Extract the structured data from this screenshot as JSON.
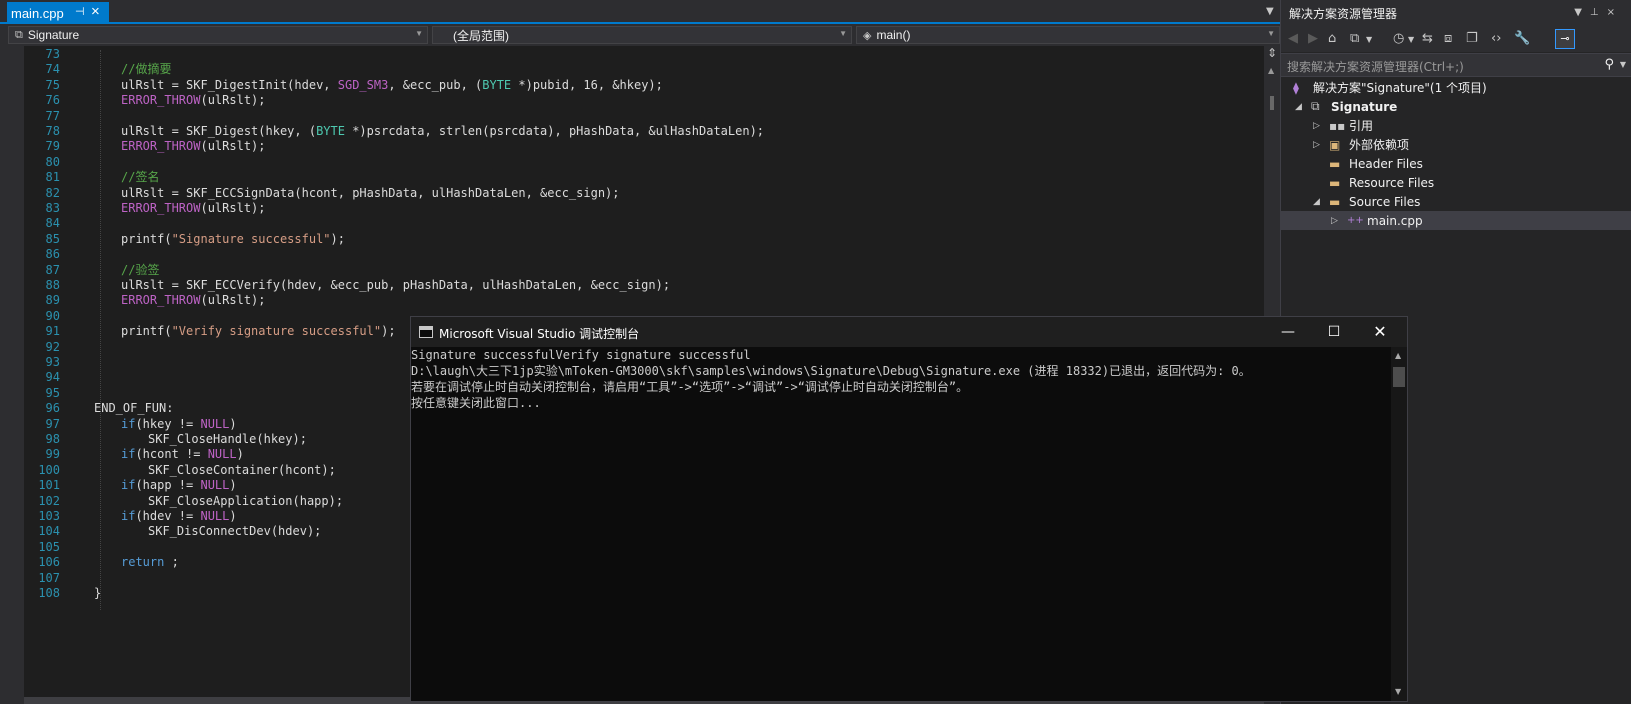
{
  "editor": {
    "tab": {
      "title": "main.cpp",
      "pin_icon": "pin-icon",
      "close_icon": "close-icon"
    },
    "nav": {
      "project": "Signature",
      "scope": "(全局范围)",
      "member": "main()"
    },
    "lines": [
      {
        "n": "73",
        "parts": []
      },
      {
        "n": "74",
        "parts": [
          {
            "t": "//做摘要",
            "c": "cmt"
          }
        ]
      },
      {
        "n": "75",
        "parts": [
          {
            "t": "ulRslt = SKF_DigestInit(hdev, ",
            "c": ""
          },
          {
            "t": "SGD_SM3",
            "c": "mac"
          },
          {
            "t": ", &ecc_pub, (",
            "c": ""
          },
          {
            "t": "BYTE",
            "c": "typ"
          },
          {
            "t": " *)pubid, 16, &hkey);",
            "c": ""
          }
        ]
      },
      {
        "n": "76",
        "parts": [
          {
            "t": "ERROR_THROW",
            "c": "mac"
          },
          {
            "t": "(ulRslt);",
            "c": ""
          }
        ]
      },
      {
        "n": "77",
        "parts": []
      },
      {
        "n": "78",
        "parts": [
          {
            "t": "ulRslt = SKF_Digest(hkey, (",
            "c": ""
          },
          {
            "t": "BYTE",
            "c": "typ"
          },
          {
            "t": " *)psrcdata, strlen(psrcdata), pHashData, &ulHashDataLen);",
            "c": ""
          }
        ]
      },
      {
        "n": "79",
        "parts": [
          {
            "t": "ERROR_THROW",
            "c": "mac"
          },
          {
            "t": "(ulRslt);",
            "c": ""
          }
        ]
      },
      {
        "n": "80",
        "parts": []
      },
      {
        "n": "81",
        "parts": [
          {
            "t": "//签名",
            "c": "cmt"
          }
        ]
      },
      {
        "n": "82",
        "parts": [
          {
            "t": "ulRslt = SKF_ECCSignData(hcont, pHashData, ulHashDataLen, &ecc_sign);",
            "c": ""
          }
        ]
      },
      {
        "n": "83",
        "parts": [
          {
            "t": "ERROR_THROW",
            "c": "mac"
          },
          {
            "t": "(ulRslt);",
            "c": ""
          }
        ]
      },
      {
        "n": "84",
        "parts": []
      },
      {
        "n": "85",
        "parts": [
          {
            "t": "printf(",
            "c": ""
          },
          {
            "t": "\"Signature successful\"",
            "c": "str"
          },
          {
            "t": ");",
            "c": ""
          }
        ]
      },
      {
        "n": "86",
        "parts": []
      },
      {
        "n": "87",
        "parts": [
          {
            "t": "//验签",
            "c": "cmt"
          }
        ]
      },
      {
        "n": "88",
        "parts": [
          {
            "t": "ulRslt = SKF_ECCVerify(hdev, &ecc_pub, pHashData, ulHashDataLen, &ecc_sign);",
            "c": ""
          }
        ]
      },
      {
        "n": "89",
        "parts": [
          {
            "t": "ERROR_THROW",
            "c": "mac"
          },
          {
            "t": "(ulRslt);",
            "c": ""
          }
        ]
      },
      {
        "n": "90",
        "parts": []
      },
      {
        "n": "91",
        "parts": [
          {
            "t": "printf(",
            "c": ""
          },
          {
            "t": "\"Verify signature successful\"",
            "c": "str"
          },
          {
            "t": ");",
            "c": ""
          }
        ]
      },
      {
        "n": "92",
        "parts": []
      },
      {
        "n": "93",
        "parts": []
      },
      {
        "n": "94",
        "parts": []
      },
      {
        "n": "95",
        "parts": []
      },
      {
        "n": "96",
        "parts": [
          {
            "t": "END_OF_FUN:",
            "c": ""
          }
        ]
      },
      {
        "n": "97",
        "parts": [
          {
            "t": "if",
            "c": "kw"
          },
          {
            "t": "(hkey != ",
            "c": ""
          },
          {
            "t": "NULL",
            "c": "mac"
          },
          {
            "t": ")",
            "c": ""
          }
        ]
      },
      {
        "n": "98",
        "parts": [
          {
            "t": "SKF_CloseHandle(hkey);",
            "c": ""
          }
        ]
      },
      {
        "n": "99",
        "parts": [
          {
            "t": "if",
            "c": "kw"
          },
          {
            "t": "(hcont != ",
            "c": ""
          },
          {
            "t": "NULL",
            "c": "mac"
          },
          {
            "t": ")",
            "c": ""
          }
        ]
      },
      {
        "n": "100",
        "parts": [
          {
            "t": "SKF_CloseContainer(hcont);",
            "c": ""
          }
        ]
      },
      {
        "n": "101",
        "parts": [
          {
            "t": "if",
            "c": "kw"
          },
          {
            "t": "(happ != ",
            "c": ""
          },
          {
            "t": "NULL",
            "c": "mac"
          },
          {
            "t": ")",
            "c": ""
          }
        ]
      },
      {
        "n": "102",
        "parts": [
          {
            "t": "SKF_CloseApplication(happ);",
            "c": ""
          }
        ]
      },
      {
        "n": "103",
        "parts": [
          {
            "t": "if",
            "c": "kw"
          },
          {
            "t": "(hdev != ",
            "c": ""
          },
          {
            "t": "NULL",
            "c": "mac"
          },
          {
            "t": ")",
            "c": ""
          }
        ]
      },
      {
        "n": "104",
        "parts": [
          {
            "t": "SKF_DisConnectDev(hdev);",
            "c": ""
          }
        ]
      },
      {
        "n": "105",
        "parts": []
      },
      {
        "n": "106",
        "parts": [
          {
            "t": "return",
            "c": "kw"
          },
          {
            "t": " ;",
            "c": ""
          }
        ]
      },
      {
        "n": "107",
        "parts": []
      },
      {
        "n": "108",
        "parts": [
          {
            "t": "}",
            "c": ""
          }
        ]
      }
    ]
  },
  "solution_explorer": {
    "title": "解决方案资源管理器",
    "search_placeholder": "搜索解决方案资源管理器(Ctrl+;)",
    "items": [
      {
        "label": "解决方案\"Signature\"(1 个项目)",
        "icon": "solution-icon",
        "expander": ""
      },
      {
        "label": "Signature",
        "icon": "project-icon",
        "expander": "expanded"
      },
      {
        "label": "引用",
        "icon": "references-icon",
        "expander": "collapsed"
      },
      {
        "label": "外部依赖项",
        "icon": "external-deps-icon",
        "expander": "collapsed"
      },
      {
        "label": "Header Files",
        "icon": "folder-icon",
        "expander": ""
      },
      {
        "label": "Resource Files",
        "icon": "folder-icon",
        "expander": ""
      },
      {
        "label": "Source Files",
        "icon": "folder-open-icon",
        "expander": "expanded"
      },
      {
        "label": "main.cpp",
        "icon": "cpp-file-icon",
        "expander": "collapsed",
        "selected": true
      }
    ]
  },
  "console": {
    "title": "Microsoft Visual Studio 调试控制台",
    "lines": [
      "Signature successfulVerify signature successful",
      "D:\\laugh\\大三下1jp实验\\mToken-GM3000\\skf\\samples\\windows\\Signature\\Debug\\Signature.exe (进程 18332)已退出，返回代码为: 0。",
      "若要在调试停止时自动关闭控制台，请启用“工具”->“选项”->“调试”->“调试停止时自动关闭控制台”。",
      "按任意键关闭此窗口..."
    ]
  },
  "colors": {
    "accent": "#007acc",
    "editor_bg": "#1e1e1e",
    "comment": "#57a64a",
    "macro": "#bd63c5",
    "string": "#d69d85",
    "type": "#4ec9b0",
    "keyword": "#569cd6",
    "line_number": "#2b91af"
  }
}
